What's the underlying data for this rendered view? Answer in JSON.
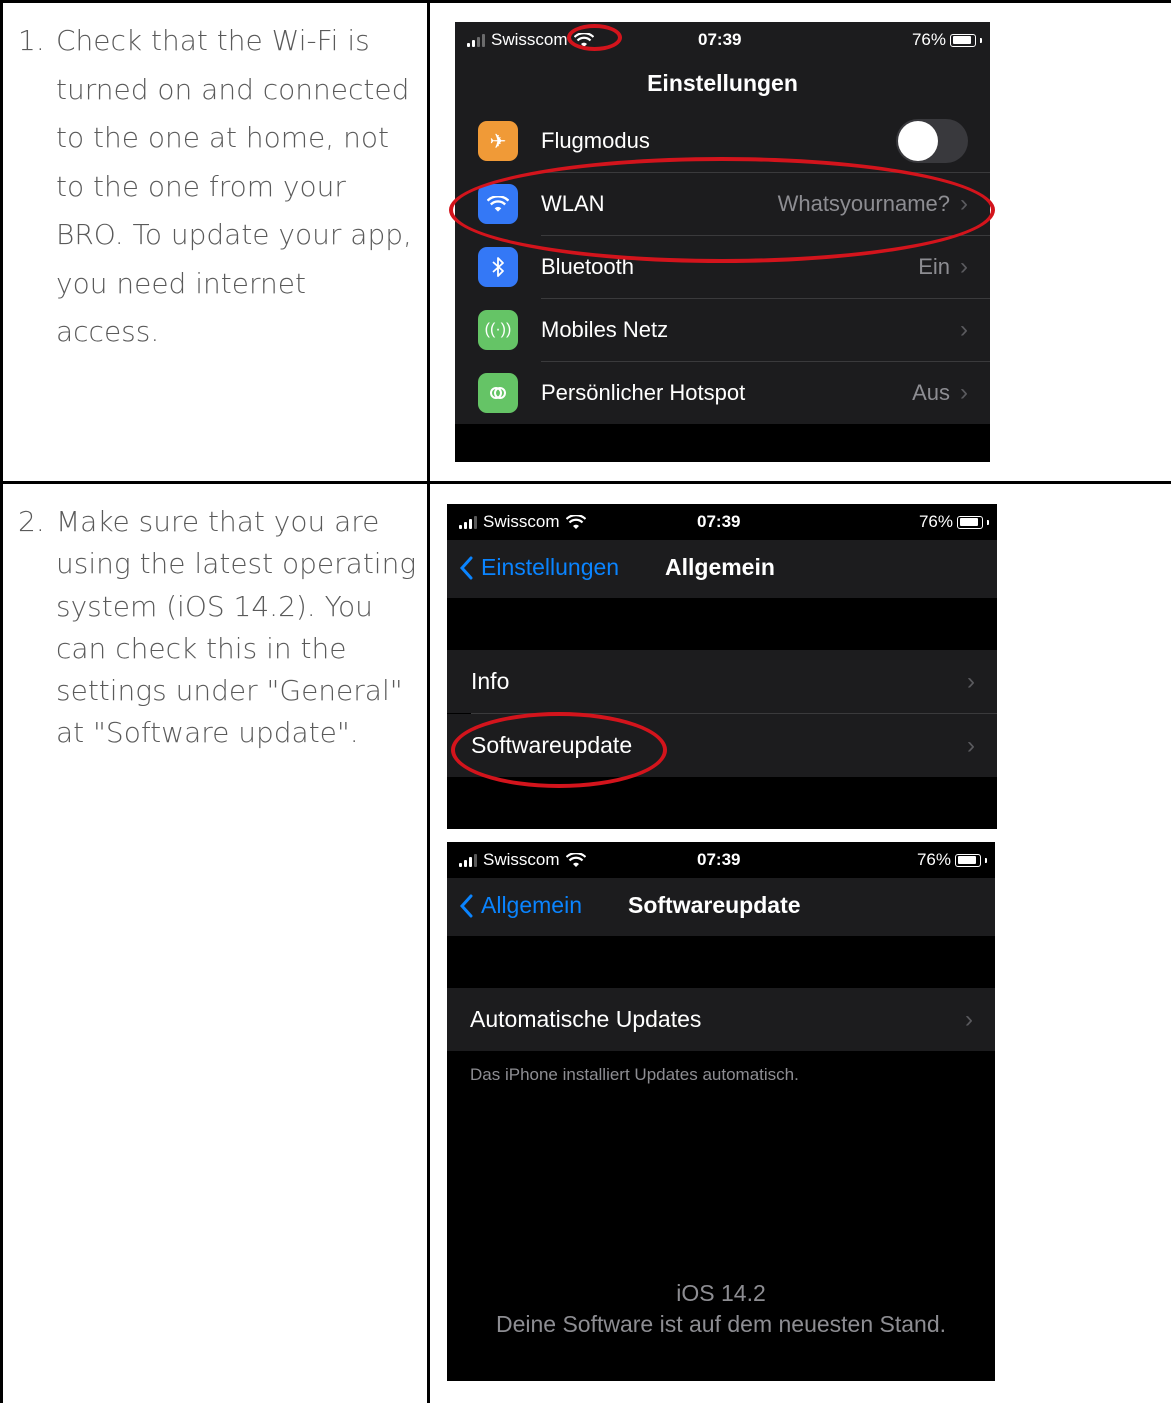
{
  "steps": [
    {
      "number": "1.",
      "text": "Check that the Wi-Fi is turned on and connected to the one at home, not to the one from your BRO. To update your app, you need internet access."
    },
    {
      "number": "2.",
      "text": "Make sure that you are using the latest operating system (iOS 14.2). You can check this in the settings under \"General\" at \"Software update\"."
    }
  ],
  "status_bar": {
    "carrier": "Swisscom",
    "time": "07:39",
    "battery": "76%"
  },
  "screen1": {
    "title": "Einstellungen",
    "rows": [
      {
        "label": "Flugmodus",
        "value": "",
        "icon": "airplane-icon",
        "color": "#f09a37"
      },
      {
        "label": "WLAN",
        "value": "Whatsyourname?",
        "icon": "wifi-icon",
        "color": "#3478f6"
      },
      {
        "label": "Bluetooth",
        "value": "Ein",
        "icon": "bluetooth-icon",
        "color": "#3478f6"
      },
      {
        "label": "Mobiles Netz",
        "value": "",
        "icon": "antenna-icon",
        "color": "#65c466"
      },
      {
        "label": "Persönlicher Hotspot",
        "value": "Aus",
        "icon": "hotspot-icon",
        "color": "#65c466"
      }
    ],
    "airplane_mode_on": false
  },
  "screen2": {
    "back_label": "Einstellungen",
    "title": "Allgemein",
    "rows": [
      {
        "label": "Info"
      },
      {
        "label": "Softwareupdate"
      }
    ]
  },
  "screen3": {
    "back_label": "Allgemein",
    "title": "Softwareupdate",
    "row_label": "Automatische Updates",
    "footnote": "Das iPhone installiert Updates automatisch.",
    "version": "iOS 14.2",
    "status": "Deine Software ist auf dem neuesten Stand."
  },
  "colors": {
    "annotation": "#d3141c",
    "ios_blue": "#0a84ff"
  }
}
